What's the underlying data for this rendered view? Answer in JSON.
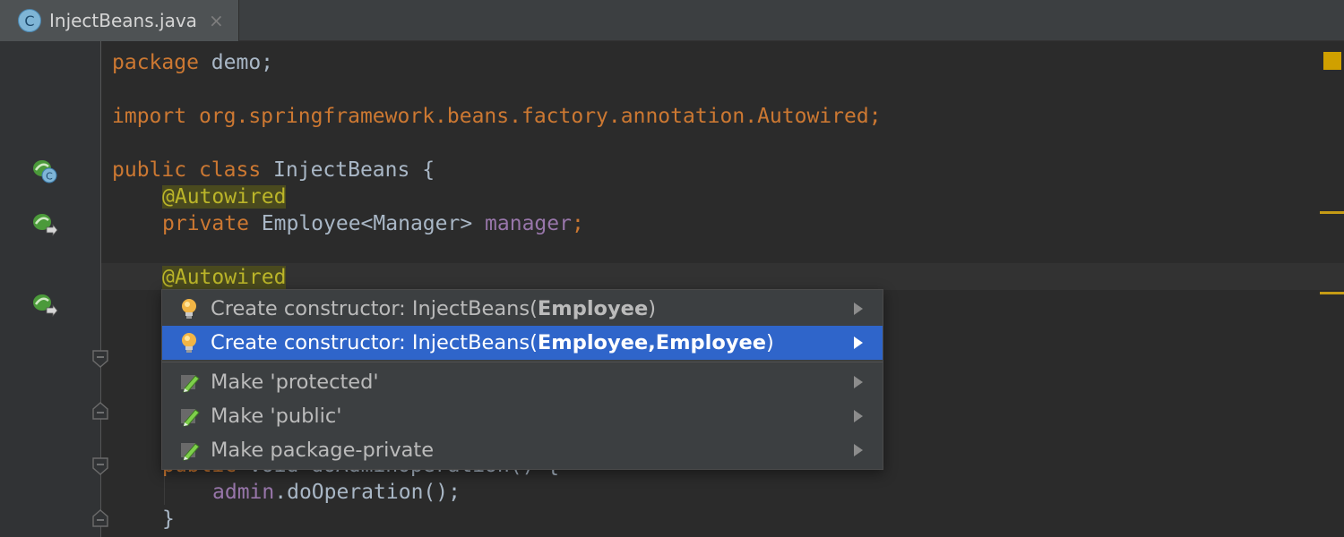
{
  "tab": {
    "icon_letter": "C",
    "title": "InjectBeans.java",
    "close": "×",
    "icon": "class-icon"
  },
  "code": {
    "line1": {
      "kw": "package",
      "rest": " demo;"
    },
    "line2": {
      "kw": "import",
      "rest": " org.springframework.beans.factory.annotation.Autowired;"
    },
    "line3": {
      "kw1": "public",
      "kw2": " class",
      "rest": " InjectBeans {"
    },
    "line4": {
      "ann": "@Autowired"
    },
    "line5": {
      "kw": "private",
      "type": " Employee<Manager> ",
      "field": "manager",
      "semi": ";"
    },
    "line6": {
      "ann": "@Autowired"
    },
    "line7": {
      "kw": "public",
      "rest": " void doAdminOperation() {"
    },
    "line8": {
      "field": "admin",
      "rest": ".doOperation();"
    },
    "line9": {
      "rest": "}"
    }
  },
  "popup": {
    "items": [
      {
        "prefix": "Create constructor: InjectBeans(",
        "bold": "Employee",
        "suffix": ")",
        "icon": "lightbulb-icon"
      },
      {
        "prefix": "Create constructor: InjectBeans(",
        "bold": "Employee,Employee",
        "suffix": ")",
        "icon": "lightbulb-icon",
        "selected": true
      },
      {
        "prefix": "Make 'protected'",
        "bold": "",
        "suffix": "",
        "icon": "pencil-icon"
      },
      {
        "prefix": "Make 'public'",
        "bold": "",
        "suffix": "",
        "icon": "pencil-icon"
      },
      {
        "prefix": "Make package-private",
        "bold": "",
        "suffix": "",
        "icon": "pencil-icon"
      }
    ]
  },
  "colors": {
    "background": "#2b2b2b",
    "keyword": "#cc7832",
    "annotation": "#bbb529",
    "field": "#9876aa",
    "selection": "#2f65ca"
  }
}
